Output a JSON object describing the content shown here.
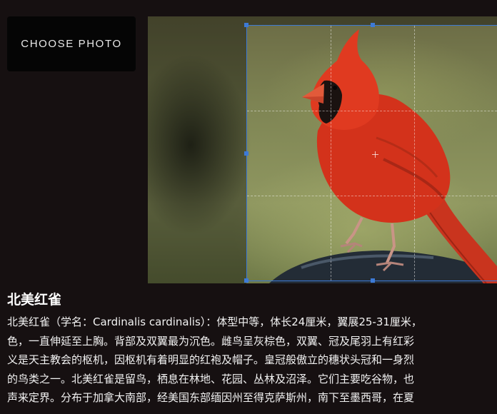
{
  "toolbar": {
    "choose_label": "CHOOSE PHOTO"
  },
  "article": {
    "title": "北美红雀",
    "lines": [
      "北美红雀（学名：Cardinalis cardinalis）：体型中等，体长24厘米，翼展25-31厘米，",
      "色，一直伸延至上胸。背部及双翼最为沉色。雌鸟呈灰棕色，双翼、冠及尾羽上有红彩",
      "义是天主教会的枢机，因枢机有着明显的红袍及帽子。皇冠般傲立的穗状头冠和一身烈",
      "的鸟类之一。北美红雀是留鸟，栖息在林地、花园、丛林及沼泽。它们主要吃谷物，也",
      "声来定界。分布于加拿大南部，经美国东部缅因州至得克萨斯州，南下至墨西哥，在夏"
    ]
  },
  "colors": {
    "accent": "#3d7ad6",
    "background": "#161011",
    "cardinal_red": "#d3321b"
  },
  "icons": {
    "crop_center": "crosshair-icon"
  }
}
